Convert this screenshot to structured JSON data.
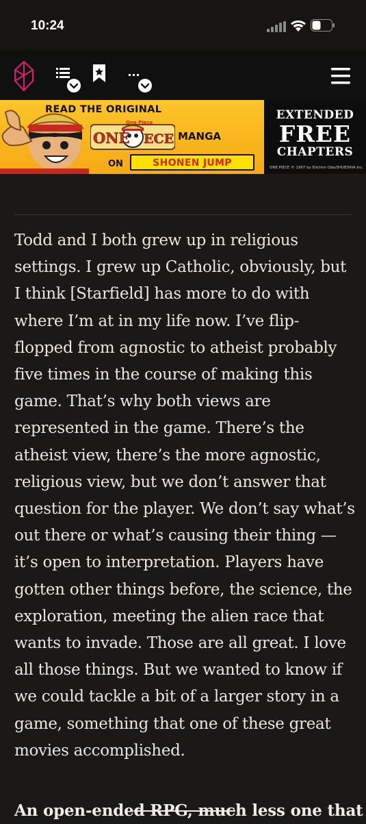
{
  "status_bar": {
    "time": "10:24"
  },
  "banner": {
    "line1": "READ THE ORIGINAL",
    "logo_top": "One Piece",
    "logo_main": "ONE PIECE",
    "line2": "MANGA",
    "line3": "ON",
    "brand": "SHONEN JUMP",
    "right_line1": "EXTENDED",
    "right_line2": "FREE",
    "right_line3": "CHAPTERS",
    "copyright": "ONE PIECE © 1997 by Eiichiro Oda/SHUEISHA Inc."
  },
  "article": {
    "paragraph": "Todd and I both grew up in religious settings. I grew up Catholic, obviously, but I think [Starfield] has more to do with where I’m at in my life now. I’ve flip-flopped from agnostic to atheist probably five times in the course of making this game. That’s why both views are represented in the game. There’s the atheist view, there’s the more agnostic, religious view, but we don’t answer that question for the player. We don’t say what’s out there or what’s causing their thing — it’s open to interpretation. Players have gotten other things before, the science, the exploration, meeting the alien race that wants to invade. Those are all great. I love all those things. But we wanted to know if we could tackle a bit of a larger story in a game, something that one of these great movies accomplished.",
    "next_start": "An open-ende",
    "next_struck": "d RPG, muc",
    "next_end": "h less one that"
  },
  "colors": {
    "page_bg": "#1a1918",
    "nav_bg": "#101010",
    "logo_accent": "#d0226a",
    "banner_yellow": "#fbc52a"
  },
  "icons": [
    "logo-icon",
    "list-icon",
    "bookmark-icon",
    "more-icon",
    "hamburger-menu-icon",
    "signal-icon",
    "wifi-icon",
    "battery-icon"
  ]
}
